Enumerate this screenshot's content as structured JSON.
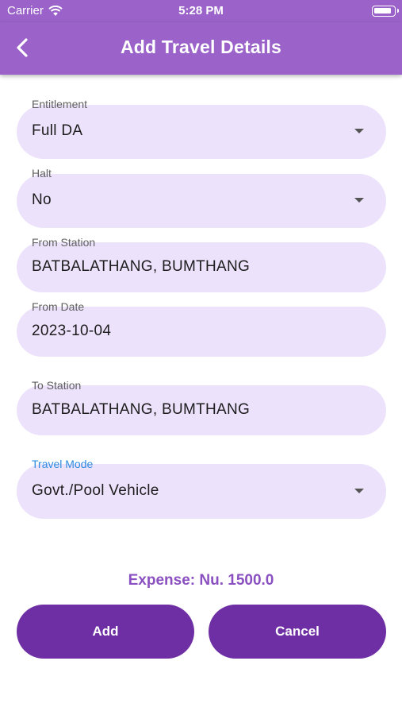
{
  "status_bar": {
    "carrier": "Carrier",
    "time": "5:28 PM"
  },
  "app_bar": {
    "title": "Add Travel Details",
    "back_icon": "chevron-left-icon"
  },
  "form": {
    "entitlement": {
      "label": "Entitlement",
      "value": "Full DA"
    },
    "halt": {
      "label": "Halt",
      "value": "No"
    },
    "from_station": {
      "label": "From Station",
      "value": "BATBALATHANG, BUMTHANG"
    },
    "from_date": {
      "label": "From Date",
      "value": "2023-10-04"
    },
    "to_station": {
      "label": "To Station",
      "value": "BATBALATHANG, BUMTHANG"
    },
    "travel_mode": {
      "label": "Travel Mode",
      "value": "Govt./Pool Vehicle"
    }
  },
  "expense": "Expense: Nu. 1500.0",
  "buttons": {
    "add": "Add",
    "cancel": "Cancel"
  },
  "colors": {
    "primary": "#9b63c9",
    "button": "#6e2fa4",
    "field_bg": "#ede2fc",
    "active_label": "#2d8ce0"
  }
}
